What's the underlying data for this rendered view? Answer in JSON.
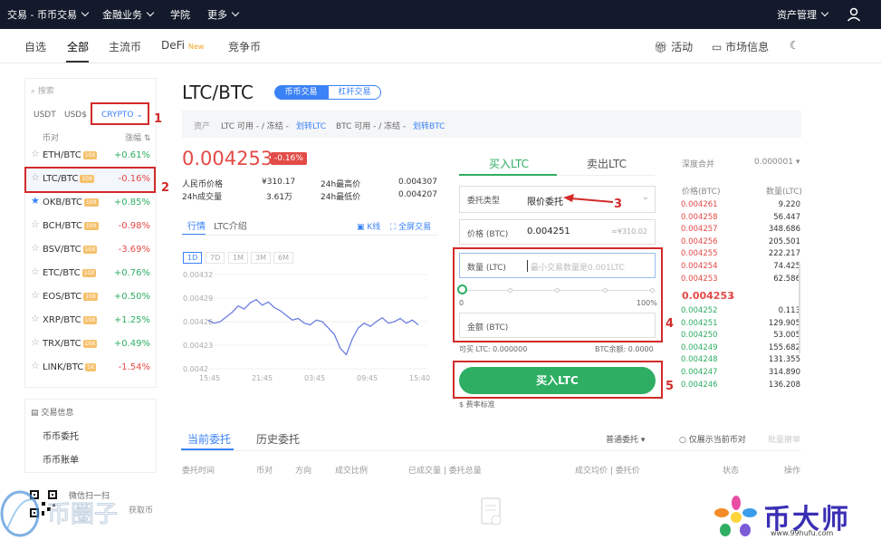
{
  "topbar": {
    "items": [
      "交易 - 币币交易",
      "金融业务",
      "学院",
      "更多"
    ],
    "asset_mgmt": "资产管理"
  },
  "subnav": {
    "items": [
      "自选",
      "全部",
      "主流币",
      "DeFi",
      "竞争币"
    ],
    "new_badge": "New",
    "activity": "活动",
    "market_info": "市场信息"
  },
  "left": {
    "search_placeholder": "搜索",
    "tabs": [
      "USDT",
      "USD$",
      "CRYPTO"
    ],
    "col_pair": "币对",
    "col_change": "涨幅",
    "rows": [
      {
        "pair": "ETH/BTC",
        "lev": "10X",
        "change": "+0.61%",
        "dir": "up"
      },
      {
        "pair": "LTC/BTC",
        "lev": "10X",
        "change": "-0.16%",
        "dir": "down"
      },
      {
        "pair": "OKB/BTC",
        "lev": "10X",
        "change": "+0.85%",
        "dir": "up"
      },
      {
        "pair": "BCH/BTC",
        "lev": "10X",
        "change": "-0.98%",
        "dir": "down"
      },
      {
        "pair": "BSV/BTC",
        "lev": "10X",
        "change": "-3.69%",
        "dir": "down"
      },
      {
        "pair": "ETC/BTC",
        "lev": "10X",
        "change": "+0.76%",
        "dir": "up"
      },
      {
        "pair": "EOS/BTC",
        "lev": "10X",
        "change": "+0.50%",
        "dir": "up"
      },
      {
        "pair": "XRP/BTC",
        "lev": "10X",
        "change": "+1.25%",
        "dir": "up"
      },
      {
        "pair": "TRX/BTC",
        "lev": "10X",
        "change": "+0.49%",
        "dir": "up"
      },
      {
        "pair": "LINK/BTC",
        "lev": "5X",
        "change": "-1.54%",
        "dir": "down"
      }
    ],
    "info_title": "交易信息",
    "order_link": "币币委托",
    "bill_link": "币币账单",
    "wechat": "微信扫一扫",
    "wechat2": "获取币"
  },
  "header": {
    "pair": "LTC/BTC",
    "tab_spot": "币币交易",
    "tab_margin": "杠杆交易",
    "assets_label": "资产",
    "ltc_avail": "LTC  可用 - / 冻结 -",
    "transfer_ltc": "划转LTC",
    "btc_avail": "BTC  可用 - / 冻结 -",
    "transfer_btc": "划转BTC"
  },
  "ticker": {
    "price": "0.004253",
    "change": "-0.16%",
    "cny_label": "人民币价格",
    "cny_value": "¥310.17",
    "vol_label": "24h成交量",
    "vol_value": "3.61万",
    "high_label": "24h最高价",
    "high_value": "0.004307",
    "low_label": "24h最低价",
    "low_value": "0.004207"
  },
  "chart_tabs": {
    "market": "行情",
    "intro": "LTC介绍",
    "kline": "K线",
    "fullscreen": "全屏交易",
    "ranges": [
      "1D",
      "7D",
      "1M",
      "3M",
      "6M"
    ]
  },
  "chart_data": {
    "type": "line",
    "x": [
      "15:45",
      "21:45",
      "03:45",
      "09:45",
      "15:40"
    ],
    "y_ticks": [
      "0.00432",
      "0.00429",
      "0.00426",
      "0.00423",
      "0.0042"
    ],
    "ylim": [
      0.0042,
      0.00432
    ],
    "values": [
      0.004262,
      0.004258,
      0.00426,
      0.004266,
      0.004272,
      0.00428,
      0.004276,
      0.004284,
      0.004288,
      0.004281,
      0.004285,
      0.004278,
      0.004274,
      0.004268,
      0.004262,
      0.004264,
      0.004258,
      0.004256,
      0.004262,
      0.00426,
      0.004252,
      0.004244,
      0.004226,
      0.004218,
      0.004238,
      0.004252,
      0.004258,
      0.004254,
      0.00426,
      0.004265,
      0.004258,
      0.00426,
      0.004264,
      0.004258,
      0.004262,
      0.004256
    ]
  },
  "trade": {
    "buy_tab": "买入LTC",
    "sell_tab": "卖出LTC",
    "order_type_label": "委托类型",
    "order_type_value": "限价委托",
    "price_label": "价格 (BTC)",
    "price_value": "0.004251",
    "price_cny": "≈¥310.02",
    "qty_label": "数量 (LTC)",
    "qty_placeholder": "最小交易数量是0.001LTC",
    "slider_min": "0",
    "slider_max": "100%",
    "amount_label": "金额 (BTC)",
    "avail_ltc": "可买 LTC: 0.000000",
    "avail_btc": "BTC余额: 0.0000",
    "buy_button": "买入LTC",
    "fee": "费率标准"
  },
  "orderbook": {
    "depth_label": "深度合并",
    "depth_value": "0.000001",
    "col_price": "价格(BTC)",
    "col_qty": "数量(LTC)",
    "asks": [
      {
        "p": "0.004261",
        "q": "9.220"
      },
      {
        "p": "0.004258",
        "q": "56.447"
      },
      {
        "p": "0.004257",
        "q": "348.686"
      },
      {
        "p": "0.004256",
        "q": "205.501"
      },
      {
        "p": "0.004255",
        "q": "222.217"
      },
      {
        "p": "0.004254",
        "q": "74.425"
      },
      {
        "p": "0.004253",
        "q": "62.586"
      }
    ],
    "last": "0.004253",
    "last_arrow": "↓",
    "bids": [
      {
        "p": "0.004252",
        "q": "0.113"
      },
      {
        "p": "0.004251",
        "q": "129.905"
      },
      {
        "p": "0.004250",
        "q": "53.005"
      },
      {
        "p": "0.004249",
        "q": "155.682"
      },
      {
        "p": "0.004248",
        "q": "131.355"
      },
      {
        "p": "0.004247",
        "q": "314.890"
      },
      {
        "p": "0.004246",
        "q": "136.208"
      }
    ]
  },
  "orders": {
    "tab_current": "当前委托",
    "tab_history": "历史委托",
    "filter": "普通委托",
    "only_current": "仅展示当前币对",
    "cancel_all": "批量撤单",
    "cols": [
      "委托时间",
      "币对",
      "方向",
      "成交比例",
      "已成交量 | 委托总量",
      "成交均价 | 委托价",
      "状态",
      "操作"
    ]
  },
  "annotations": [
    "1",
    "2",
    "3",
    "4",
    "5"
  ],
  "watermark": {
    "brand": "币大师",
    "url": "www.99hufu.com",
    "left_logo": "币圈子"
  },
  "colors": {
    "up": "#2eae63",
    "down": "#e24b47",
    "accent": "#3b82f6",
    "buy": "#2eae63",
    "annot": "#d32a2a"
  }
}
